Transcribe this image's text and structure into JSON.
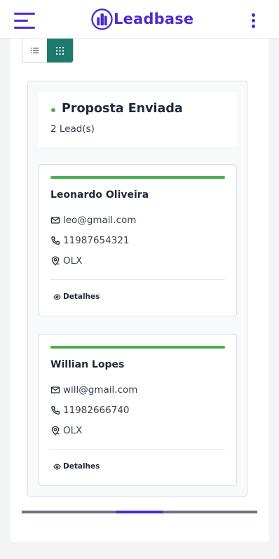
{
  "app": {
    "brand": "Leadbase",
    "brand_color": "#4c2ad1"
  },
  "header": {
    "menu_icon": "hamburger-menu-icon",
    "more_icon": "vertical-dots-icon"
  },
  "view_toggle": {
    "list_icon": "list-view-icon",
    "grid_icon": "grid-view-icon",
    "active": "grid",
    "active_color": "#1f7a6e"
  },
  "column": {
    "title": "Proposta Enviada",
    "count_label": "2 Lead(s)",
    "status_color": "#4caf50",
    "leads": [
      {
        "name": "Leonardo Oliveira",
        "email": "leo@gmail.com",
        "phone": "11987654321",
        "source": "OLX",
        "details_label": "Detalhes"
      },
      {
        "name": "Willian Lopes",
        "email": "will@gmail.com",
        "phone": "11982666740",
        "source": "OLX",
        "details_label": "Detalhes"
      }
    ]
  },
  "scrollbar": {
    "position_fraction": 0.4,
    "thumb_fraction": 0.2
  }
}
